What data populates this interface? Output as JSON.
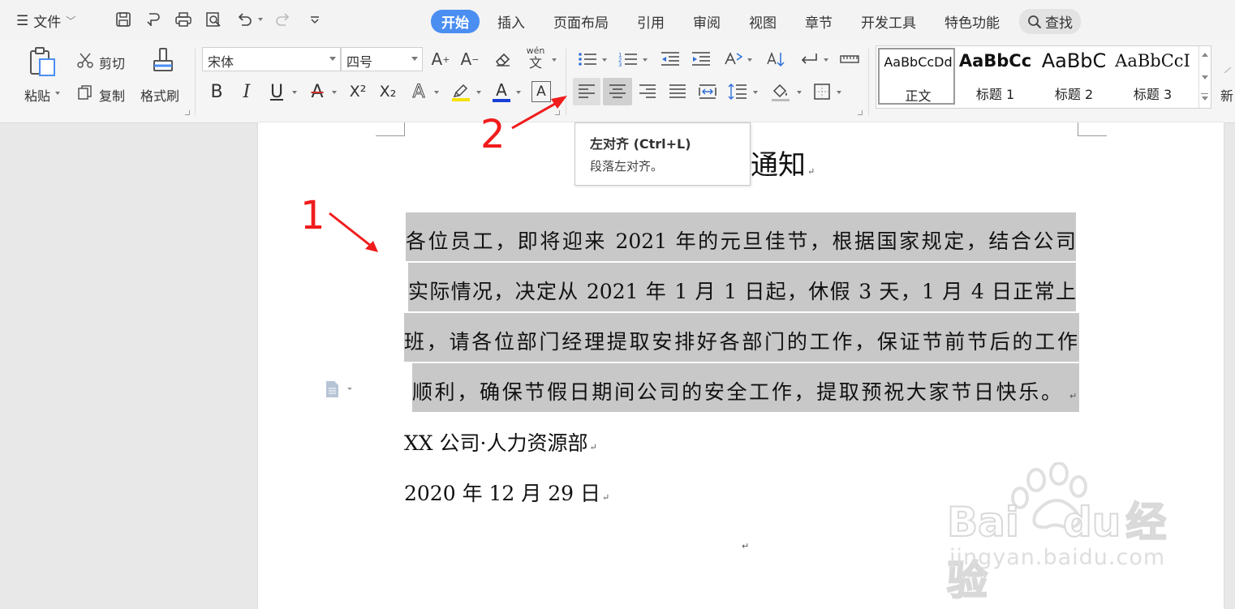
{
  "menu": {
    "file_label": "文件"
  },
  "tabs": [
    {
      "label": "开始"
    },
    {
      "label": "插入"
    },
    {
      "label": "页面布局"
    },
    {
      "label": "引用"
    },
    {
      "label": "审阅"
    },
    {
      "label": "视图"
    },
    {
      "label": "章节"
    },
    {
      "label": "开发工具"
    },
    {
      "label": "特色功能"
    },
    {
      "label": "查找"
    }
  ],
  "clipboard": {
    "paste": "粘贴",
    "cut": "剪切",
    "copy": "复制",
    "format_painter": "格式刷"
  },
  "font": {
    "name": "宋体",
    "size": "四号"
  },
  "font_tools": {
    "grow": "A",
    "shrink": "A",
    "pinyin": "wén",
    "bold": "B",
    "italic": "I",
    "underline": "U",
    "strike": "A",
    "superscript": "X²",
    "subscript": "X₂",
    "effect": "A",
    "font_color": "A",
    "char_border": "A"
  },
  "styles": [
    {
      "preview": "AaBbCcDd",
      "name": "正文"
    },
    {
      "preview": "AaBbCc",
      "name": "标题 1"
    },
    {
      "preview": "AaBbC",
      "name": "标题 2"
    },
    {
      "preview": "AaBbCcI",
      "name": "标题 3"
    }
  ],
  "new_style_label": "新",
  "tooltip": {
    "title": "左对齐 (Ctrl+L)",
    "description": "段落左对齐。"
  },
  "document": {
    "title_visible": "通知",
    "body_lines": [
      "各位员工，即将迎来 2021 年的元旦佳节，根据国家规定，结合公司",
      "实际情况，决定从 2021 年 1 月 1 日起，休假 3 天，1 月 4 日正常上",
      "班，请各位部门经理提取安排好各部门的工作，保证节前节后的工作",
      "顺利，确保节假日期间公司的安全工作，提取预祝大家节日快乐。"
    ],
    "signature": "XX 公司·人力资源部",
    "date": "2020 年 12 月 29 日"
  },
  "annotations": {
    "step1": "1",
    "step2": "2",
    "arrow_color": "#f11c1c"
  },
  "watermark": {
    "brand": "Bai",
    "brand2": "du",
    "brand3": "经验",
    "url": "jingyan.baidu.com"
  },
  "colors": {
    "active_tab": "#4a8ef2",
    "selection": "#c8c8c8",
    "highlight_bar": "#f5e100",
    "font_color_bar": "#1a3fd8",
    "strike_color": "#d02c2c"
  }
}
